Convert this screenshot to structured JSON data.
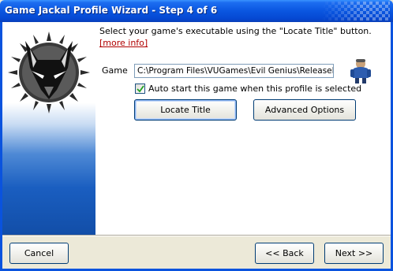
{
  "window": {
    "title": "Game Jackal Profile Wizard - Step 4 of 6"
  },
  "body": {
    "instruction": "Select your game's executable using the \"Locate Title\" button.",
    "more_info_link": "[more info]",
    "game_label": "Game",
    "game_path": "C:\\Program Files\\VUGames\\Evil Genius\\ReleaseExe\\E",
    "auto_start_label": "Auto start this game when this profile is selected",
    "auto_start_checked": true,
    "locate_button": "Locate Title",
    "advanced_button": "Advanced Options"
  },
  "footer": {
    "cancel": "Cancel",
    "back": "<< Back",
    "next": "Next >>"
  },
  "icons": {
    "logo": "fox-head-logo",
    "game_icon": "game-character-icon",
    "checkbox": "checkmark-icon"
  },
  "colors": {
    "titlebar": "#0a56e0",
    "link": "#b00000",
    "panel_gradient_bottom": "#124ea8"
  }
}
